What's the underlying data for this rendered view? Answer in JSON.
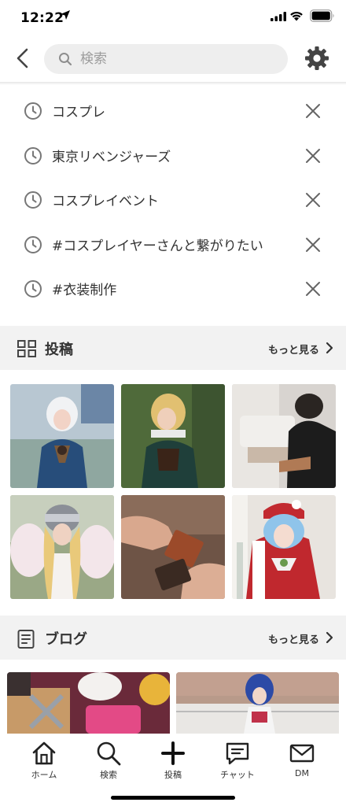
{
  "status_bar": {
    "time": "12:22"
  },
  "search": {
    "placeholder": "検索"
  },
  "history": [
    {
      "label": "コスプレ"
    },
    {
      "label": "東京リベンジャーズ"
    },
    {
      "label": "コスプレイベント"
    },
    {
      "label": "#コスプレイヤーさんと繋がりたい"
    },
    {
      "label": "#衣装制作"
    }
  ],
  "posts_section": {
    "title": "投稿",
    "more": "もっと見る"
  },
  "blog_section": {
    "title": "ブログ",
    "more": "もっと見る"
  },
  "tabs": [
    {
      "label": "ホーム",
      "icon": "home-icon"
    },
    {
      "label": "検索",
      "icon": "search-icon"
    },
    {
      "label": "投稿",
      "icon": "plus-icon"
    },
    {
      "label": "チャット",
      "icon": "chat-icon"
    },
    {
      "label": "DM",
      "icon": "mail-icon"
    }
  ],
  "colors": {
    "text": "#333333",
    "band": "#f2f2f2",
    "search_bg": "#eeeeee"
  }
}
